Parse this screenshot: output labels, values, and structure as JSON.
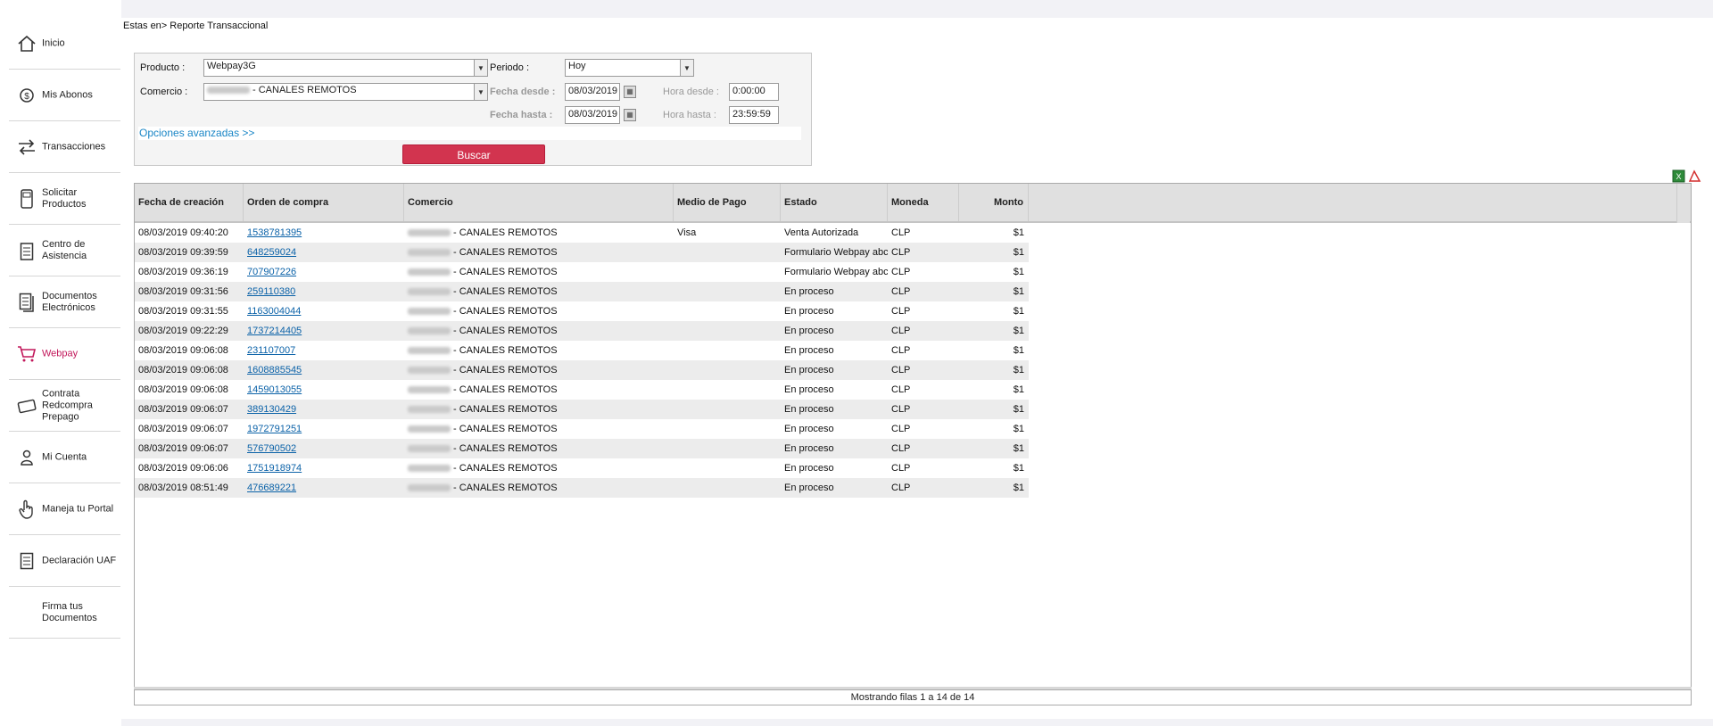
{
  "sidebar": {
    "items": [
      {
        "label": "Inicio",
        "icon": "home-icon"
      },
      {
        "label": "Mis Abonos",
        "icon": "money-icon"
      },
      {
        "label": "Transacciones",
        "icon": "transfer-icon"
      },
      {
        "label": "Solicitar Productos",
        "icon": "pos-terminal-icon"
      },
      {
        "label": "Centro de Asistencia",
        "icon": "clipboard-icon"
      },
      {
        "label": "Documentos Electrónicos",
        "icon": "documents-icon"
      },
      {
        "label": "Webpay",
        "icon": "cart-icon",
        "active": true
      },
      {
        "label": "Contrata Redcompra Prepago",
        "icon": "card-icon"
      },
      {
        "label": "Mi Cuenta",
        "icon": "user-icon"
      },
      {
        "label": "Maneja tu Portal",
        "icon": "hand-pointer-icon"
      },
      {
        "label": "Declaración UAF",
        "icon": "form-icon"
      },
      {
        "label": "Firma tus Documentos",
        "icon": ""
      }
    ],
    "active_color": "#c2185b"
  },
  "breadcrumb": "Estas en> Reporte Transaccional",
  "filters": {
    "producto_label": "Producto :",
    "producto_value": "Webpay3G",
    "comercio_label": "Comercio :",
    "comercio_value": "- CANALES REMOTOS",
    "periodo_label": "Periodo :",
    "periodo_value": "Hoy",
    "fecha_desde_label": "Fecha desde :",
    "fecha_desde_value": "08/03/2019",
    "fecha_hasta_label": "Fecha hasta :",
    "fecha_hasta_value": "08/03/2019",
    "hora_desde_label": "Hora desde :",
    "hora_desde_value": "0:00:00",
    "hora_hasta_label": "Hora hasta :",
    "hora_hasta_value": "23:59:59",
    "advanced_link": "Opciones avanzadas >>",
    "search_button": "Buscar"
  },
  "table": {
    "columns": [
      "Fecha de creación",
      "Orden de compra",
      "Comercio",
      "Medio de Pago",
      "Estado",
      "Moneda",
      "Monto"
    ],
    "rows": [
      [
        "08/03/2019 09:40:20",
        "1538781395",
        "- CANALES REMOTOS",
        "Visa",
        "Venta Autorizada",
        "CLP",
        "$1"
      ],
      [
        "08/03/2019 09:39:59",
        "648259024",
        "- CANALES REMOTOS",
        "",
        "Formulario Webpay abc",
        "CLP",
        "$1"
      ],
      [
        "08/03/2019 09:36:19",
        "707907226",
        "- CANALES REMOTOS",
        "",
        "Formulario Webpay abc",
        "CLP",
        "$1"
      ],
      [
        "08/03/2019 09:31:56",
        "259110380",
        "- CANALES REMOTOS",
        "",
        "En proceso",
        "CLP",
        "$1"
      ],
      [
        "08/03/2019 09:31:55",
        "1163004044",
        "- CANALES REMOTOS",
        "",
        "En proceso",
        "CLP",
        "$1"
      ],
      [
        "08/03/2019 09:22:29",
        "1737214405",
        "- CANALES REMOTOS",
        "",
        "En proceso",
        "CLP",
        "$1"
      ],
      [
        "08/03/2019 09:06:08",
        "231107007",
        "- CANALES REMOTOS",
        "",
        "En proceso",
        "CLP",
        "$1"
      ],
      [
        "08/03/2019 09:06:08",
        "1608885545",
        "- CANALES REMOTOS",
        "",
        "En proceso",
        "CLP",
        "$1"
      ],
      [
        "08/03/2019 09:06:08",
        "1459013055",
        "- CANALES REMOTOS",
        "",
        "En proceso",
        "CLP",
        "$1"
      ],
      [
        "08/03/2019 09:06:07",
        "389130429",
        "- CANALES REMOTOS",
        "",
        "En proceso",
        "CLP",
        "$1"
      ],
      [
        "08/03/2019 09:06:07",
        "1972791251",
        "- CANALES REMOTOS",
        "",
        "En proceso",
        "CLP",
        "$1"
      ],
      [
        "08/03/2019 09:06:07",
        "576790502",
        "- CANALES REMOTOS",
        "",
        "En proceso",
        "CLP",
        "$1"
      ],
      [
        "08/03/2019 09:06:06",
        "1751918974",
        "- CANALES REMOTOS",
        "",
        "En proceso",
        "CLP",
        "$1"
      ],
      [
        "08/03/2019 08:51:49",
        "476689221",
        "- CANALES REMOTOS",
        "",
        "En proceso",
        "CLP",
        "$1"
      ]
    ],
    "footer": "Mostrando filas 1 a 14 de 14"
  },
  "export": {
    "excel_icon": "excel-export-icon",
    "pdf_icon": "pdf-export-icon"
  },
  "colors": {
    "accent": "#d2344f",
    "link": "#0b62a8"
  }
}
